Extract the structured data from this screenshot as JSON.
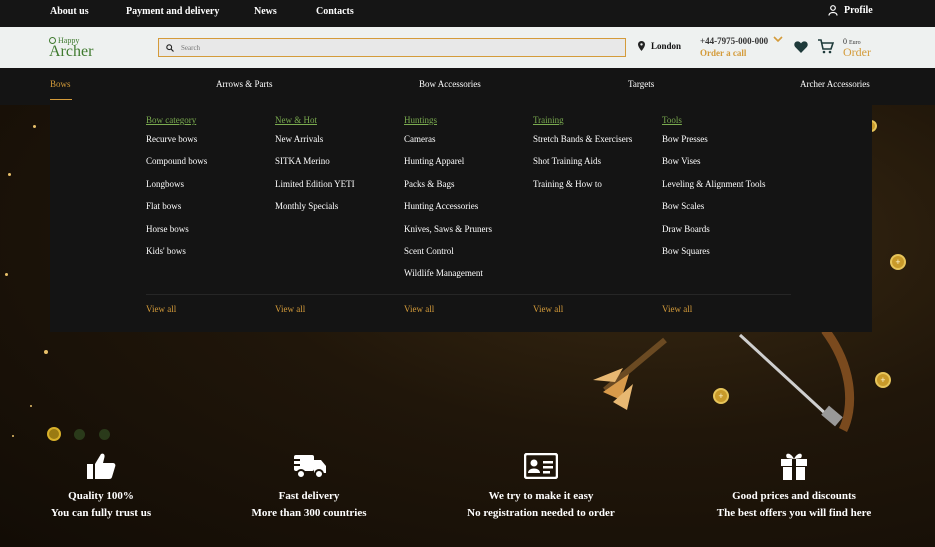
{
  "topbar": {
    "links": [
      "About us",
      "Payment and delivery",
      "News",
      "Contacts"
    ],
    "profile": "Profile"
  },
  "header": {
    "logo_small": "Happy",
    "logo_big": "Archer",
    "search_placeholder": "Search",
    "location": "London",
    "phone": "+44-7975-000-000",
    "order_call": "Order a call",
    "cart_amount": "0",
    "cart_currency": "Euro",
    "cart_order": "Order"
  },
  "nav": {
    "items": [
      "Bows",
      "Arrows & Parts",
      "Bow Accessories",
      "Targets",
      "Archer Accessories"
    ]
  },
  "menu": {
    "view_all": "View all",
    "columns": [
      {
        "title": "Bow category",
        "links": [
          "Recurve bows",
          "Compound bows",
          "Longbows",
          "Flat bows",
          "Horse bows",
          "Kids' bows"
        ]
      },
      {
        "title": "New & Hot",
        "links": [
          "New Arrivals",
          "SITKA Merino",
          "Limited Edition YETI",
          "Monthly Specials"
        ]
      },
      {
        "title": "Huntings",
        "links": [
          "Cameras",
          "Hunting Apparel",
          "Packs & Bags",
          "Hunting Accessories",
          "Knives, Saws & Pruners",
          "Scent Control",
          "Wildlife Management"
        ]
      },
      {
        "title": "Training",
        "links": [
          "Stretch Bands & Exercisers",
          "Shot Training Aids",
          "Training & How to"
        ]
      },
      {
        "title": "Tools",
        "links": [
          "Bow Presses",
          "Bow Vises",
          "Leveling & Alignment Tools",
          "Bow Scales",
          "Draw Boards",
          "Bow Squares"
        ]
      }
    ]
  },
  "features": [
    {
      "icon": "thumbs-up-icon",
      "title": "Quality 100%",
      "sub": "You can fully trust us"
    },
    {
      "icon": "delivery-truck-icon",
      "title": "Fast delivery",
      "sub": "More than 300 countries"
    },
    {
      "icon": "id-card-icon",
      "title": "We try to make it easy",
      "sub": "No registration needed to order"
    },
    {
      "icon": "gift-icon",
      "title": "Good prices and discounts",
      "sub": "The best offers you will find here"
    }
  ],
  "colors": {
    "accent": "#d49b3a",
    "green": "#7aab4f",
    "dark": "#141414"
  }
}
